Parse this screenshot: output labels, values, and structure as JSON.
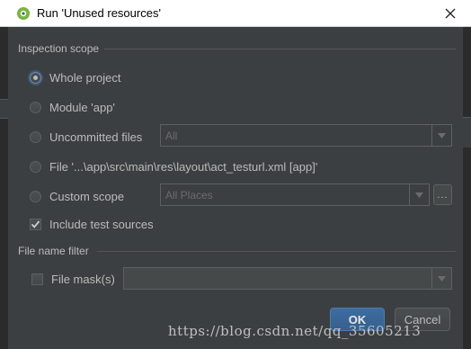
{
  "window": {
    "title": "Run 'Unused resources'",
    "app_icon": "android-studio-icon",
    "close_icon": "close-icon"
  },
  "scope": {
    "section_label": "Inspection scope",
    "options": [
      {
        "label": "Whole project",
        "selected": true
      },
      {
        "label": "Module 'app'",
        "selected": false
      },
      {
        "label": "Uncommitted files",
        "selected": false,
        "combo_value": "All"
      },
      {
        "label": "File '...\\app\\src\\main\\res\\layout\\act_testurl.xml [app]'",
        "selected": false
      },
      {
        "label": "Custom scope",
        "selected": false,
        "combo_value": "All Places",
        "more_label": "..."
      }
    ],
    "include_test_sources": {
      "label": "Include test sources",
      "checked": true
    }
  },
  "file_filter": {
    "section_label": "File name filter",
    "mask": {
      "label": "File mask(s)",
      "checked": false,
      "value": ""
    }
  },
  "buttons": {
    "ok": "OK",
    "cancel": "Cancel"
  },
  "watermark": "https://blog.csdn.net/qq_35605213",
  "colors": {
    "dialog_bg": "#3c3f41",
    "text": "#bbbbbb",
    "accent": "#365f8d"
  }
}
